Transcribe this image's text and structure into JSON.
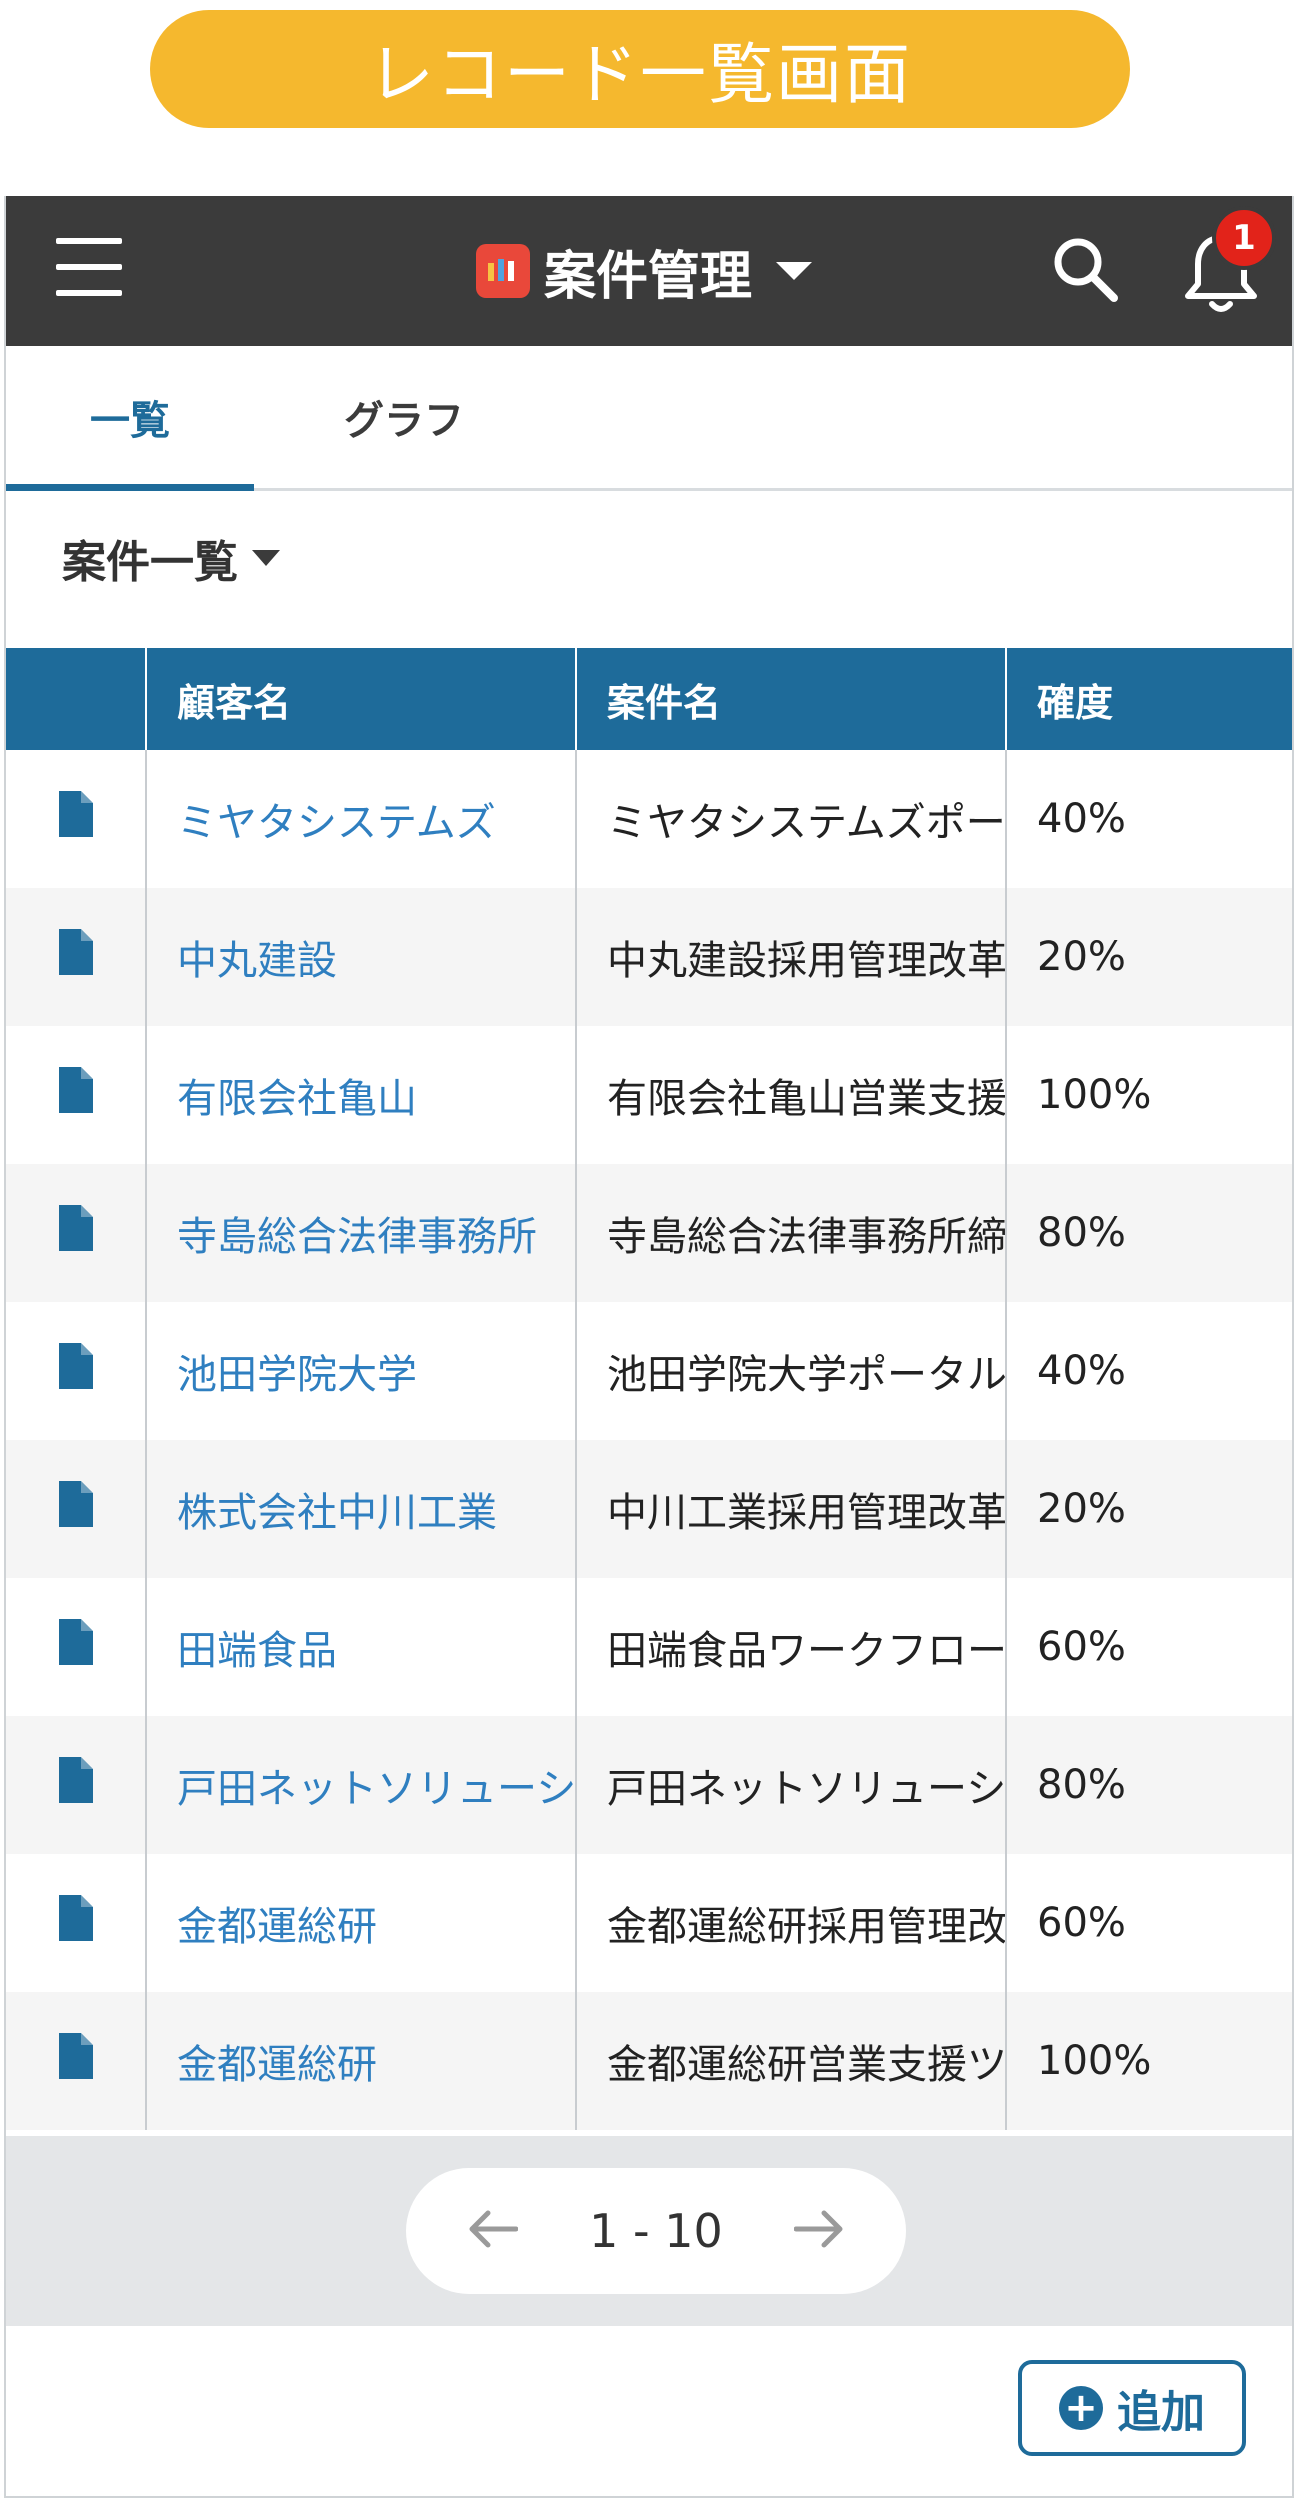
{
  "caption": "レコード一覧画面",
  "header": {
    "title": "案件管理",
    "notification_count": "1"
  },
  "tabs": [
    {
      "label": "一覧",
      "active": true
    },
    {
      "label": "グラフ",
      "active": false
    }
  ],
  "view": {
    "label": "案件一覧"
  },
  "table": {
    "columns": [
      "",
      "顧客名",
      "案件名",
      "確度"
    ],
    "rows": [
      {
        "customer": "ミヤタシステムズ",
        "project": "ミヤタシステムズポー",
        "probability": "40%"
      },
      {
        "customer": "中丸建設",
        "project": "中丸建設採用管理改革",
        "probability": "20%"
      },
      {
        "customer": "有限会社亀山",
        "project": "有限会社亀山営業支援",
        "probability": "100%"
      },
      {
        "customer": "寺島総合法律事務所",
        "project": "寺島総合法律事務所締",
        "probability": "80%"
      },
      {
        "customer": "池田学院大学",
        "project": "池田学院大学ポータル",
        "probability": "40%"
      },
      {
        "customer": "株式会社中川工業",
        "project": "中川工業採用管理改革",
        "probability": "20%"
      },
      {
        "customer": "田端食品",
        "project": "田端食品ワークフロー",
        "probability": "60%"
      },
      {
        "customer": "戸田ネットソリューシ",
        "project": "戸田ネットソリューシ",
        "probability": "80%"
      },
      {
        "customer": "金都運総研",
        "project": "金都運総研採用管理改",
        "probability": "60%"
      },
      {
        "customer": "金都運総研",
        "project": "金都運総研営業支援ツ",
        "probability": "100%"
      }
    ]
  },
  "pager": {
    "range": "1 - 10"
  },
  "add_button": {
    "label": "追加"
  },
  "colors": {
    "accent": "#1e6b9a",
    "link": "#2f7fc0",
    "caption": "#f5b82e",
    "appbar": "#3b3b3b",
    "badge": "#e2231a"
  }
}
